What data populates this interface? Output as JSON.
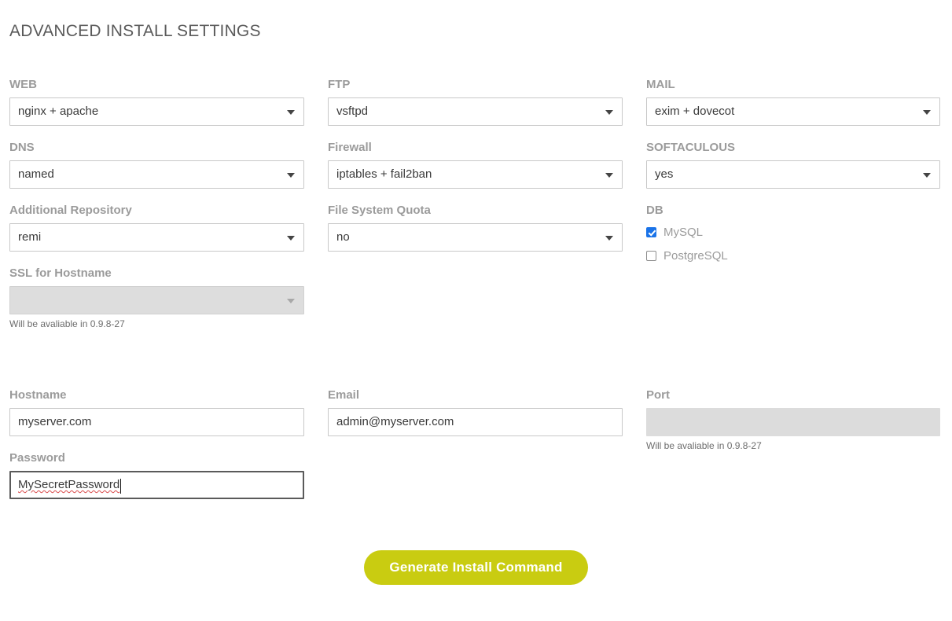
{
  "page": {
    "title": "ADVANCED INSTALL SETTINGS"
  },
  "columns": {
    "col1": [
      {
        "name": "web",
        "label": "WEB",
        "type": "select",
        "value": "nginx + apache",
        "disabled": false
      },
      {
        "name": "dns",
        "label": "DNS",
        "type": "select",
        "value": "named",
        "disabled": false
      },
      {
        "name": "additional-repository",
        "label": "Additional Repository",
        "type": "select",
        "value": "remi",
        "disabled": false
      },
      {
        "name": "ssl-for-hostname",
        "label": "SSL for Hostname",
        "type": "select",
        "value": "",
        "disabled": true,
        "hint": "Will be avaliable in 0.9.8-27"
      }
    ],
    "col2": [
      {
        "name": "ftp",
        "label": "FTP",
        "type": "select",
        "value": "vsftpd",
        "disabled": false
      },
      {
        "name": "firewall",
        "label": "Firewall",
        "type": "select",
        "value": "iptables + fail2ban",
        "disabled": false
      },
      {
        "name": "file-system-quota",
        "label": "File System Quota",
        "type": "select",
        "value": "no",
        "disabled": false
      }
    ],
    "col3": [
      {
        "name": "mail",
        "label": "MAIL",
        "type": "select",
        "value": "exim + dovecot",
        "disabled": false
      },
      {
        "name": "softaculous",
        "label": "SOFTACULOUS",
        "type": "select",
        "value": "yes",
        "disabled": false
      }
    ]
  },
  "db": {
    "label": "DB",
    "options": [
      {
        "name": "mysql",
        "label": "MySQL",
        "checked": true
      },
      {
        "name": "postgresql",
        "label": "PostgreSQL",
        "checked": false
      }
    ]
  },
  "bottom": {
    "hostname": {
      "label": "Hostname",
      "value": "myserver.com",
      "disabled": false,
      "focused": false
    },
    "password": {
      "label": "Password",
      "value": "MySecretPassword",
      "disabled": false,
      "focused": true
    },
    "email": {
      "label": "Email",
      "value": "admin@myserver.com",
      "disabled": false,
      "focused": false
    },
    "port": {
      "label": "Port",
      "value": "",
      "disabled": true,
      "focused": false,
      "hint": "Will be avaliable in 0.9.8-27"
    }
  },
  "submit": {
    "label": "Generate Install Command",
    "color": "#c9cc11"
  },
  "colors": {
    "title": "#5a5a5a",
    "label": "#9b9b9b",
    "value": "#3a3a3a",
    "border": "#c8c8c8",
    "disabled_bg": "#dddddd",
    "accent_checkbox": "#1a73e8",
    "accent_button": "#c9cc11",
    "spellcheck_underline": "#d94b4b"
  }
}
